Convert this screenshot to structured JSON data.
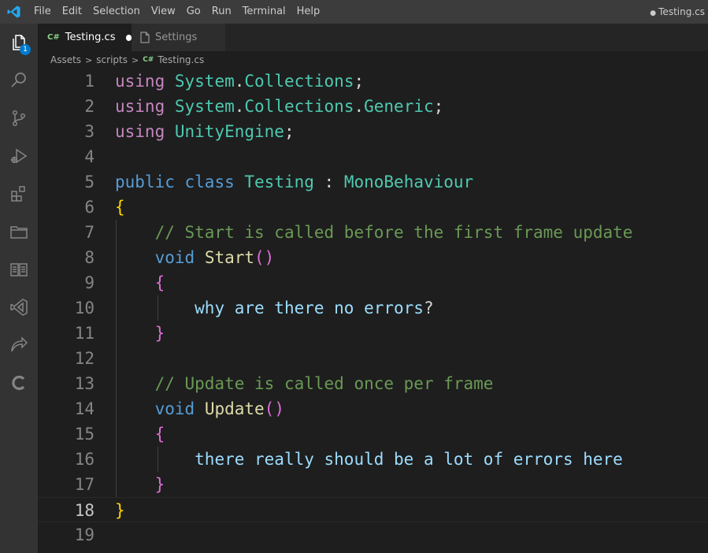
{
  "titlebar": {
    "menu": [
      "File",
      "Edit",
      "Selection",
      "View",
      "Go",
      "Run",
      "Terminal",
      "Help"
    ],
    "window_title": "Testing.cs",
    "modified_indicator": "●"
  },
  "activity_bar": {
    "explorer_badge": "1",
    "icons": [
      "explorer-icon",
      "search-icon",
      "source-control-icon",
      "run-debug-icon",
      "extensions-icon",
      "folder-icon",
      "book-icon",
      "visual-studio-icon",
      "remote-icon",
      "c-icon"
    ]
  },
  "tabs": [
    {
      "label": "Testing.cs",
      "icon": "C#",
      "modified": true,
      "active": true
    },
    {
      "label": "Settings",
      "icon": "file-icon",
      "active": false
    }
  ],
  "breadcrumb": [
    "Assets",
    "scripts",
    "Testing.cs"
  ],
  "breadcrumb_file_icon": "C#",
  "colors": {
    "keyword_control": "#c586c0",
    "keyword": "#569cd6",
    "type": "#4ec9b0",
    "comment": "#6a9955",
    "function": "#dcdcaa",
    "variable": "#9cdcfe",
    "text": "#d4d4d4",
    "bracket_1": "#ffd700",
    "bracket_2": "#da70d6",
    "accent": "#007acc"
  },
  "editor": {
    "current_line": 18,
    "lines": [
      {
        "n": "1",
        "tokens": [
          [
            "using",
            "keyword_control"
          ],
          [
            " ",
            "text"
          ],
          [
            "System",
            "type"
          ],
          [
            ".",
            "text"
          ],
          [
            "Collections",
            "type"
          ],
          [
            ";",
            "text"
          ]
        ]
      },
      {
        "n": "2",
        "tokens": [
          [
            "using",
            "keyword_control"
          ],
          [
            " ",
            "text"
          ],
          [
            "System",
            "type"
          ],
          [
            ".",
            "text"
          ],
          [
            "Collections",
            "type"
          ],
          [
            ".",
            "text"
          ],
          [
            "Generic",
            "type"
          ],
          [
            ";",
            "text"
          ]
        ]
      },
      {
        "n": "3",
        "tokens": [
          [
            "using",
            "keyword_control"
          ],
          [
            " ",
            "text"
          ],
          [
            "UnityEngine",
            "type"
          ],
          [
            ";",
            "text"
          ]
        ]
      },
      {
        "n": "4",
        "tokens": []
      },
      {
        "n": "5",
        "tokens": [
          [
            "public",
            "keyword"
          ],
          [
            " ",
            "text"
          ],
          [
            "class",
            "keyword"
          ],
          [
            " ",
            "text"
          ],
          [
            "Testing",
            "type"
          ],
          [
            " : ",
            "text"
          ],
          [
            "MonoBehaviour",
            "type"
          ]
        ]
      },
      {
        "n": "6",
        "tokens": [
          [
            "{",
            "bracket_1"
          ]
        ]
      },
      {
        "n": "7",
        "tokens": [
          [
            "    ",
            "text"
          ],
          [
            "// Start is called before the first frame update",
            "comment"
          ]
        ]
      },
      {
        "n": "8",
        "tokens": [
          [
            "    ",
            "text"
          ],
          [
            "void",
            "keyword"
          ],
          [
            " ",
            "text"
          ],
          [
            "Start",
            "function"
          ],
          [
            "()",
            "bracket_2"
          ]
        ]
      },
      {
        "n": "9",
        "tokens": [
          [
            "    ",
            "text"
          ],
          [
            "{",
            "bracket_2"
          ]
        ]
      },
      {
        "n": "10",
        "tokens": [
          [
            "        ",
            "text"
          ],
          [
            "why are there no errors",
            "variable"
          ],
          [
            "?",
            "text"
          ]
        ]
      },
      {
        "n": "11",
        "tokens": [
          [
            "    ",
            "text"
          ],
          [
            "}",
            "bracket_2"
          ]
        ]
      },
      {
        "n": "12",
        "tokens": []
      },
      {
        "n": "13",
        "tokens": [
          [
            "    ",
            "text"
          ],
          [
            "// Update is called once per frame",
            "comment"
          ]
        ]
      },
      {
        "n": "14",
        "tokens": [
          [
            "    ",
            "text"
          ],
          [
            "void",
            "keyword"
          ],
          [
            " ",
            "text"
          ],
          [
            "Update",
            "function"
          ],
          [
            "()",
            "bracket_2"
          ]
        ]
      },
      {
        "n": "15",
        "tokens": [
          [
            "    ",
            "text"
          ],
          [
            "{",
            "bracket_2"
          ]
        ]
      },
      {
        "n": "16",
        "tokens": [
          [
            "        ",
            "text"
          ],
          [
            "there really should be a lot of errors here",
            "variable"
          ]
        ]
      },
      {
        "n": "17",
        "tokens": [
          [
            "    ",
            "text"
          ],
          [
            "}",
            "bracket_2"
          ]
        ]
      },
      {
        "n": "18",
        "tokens": [
          [
            "}",
            "bracket_1"
          ]
        ]
      },
      {
        "n": "19",
        "tokens": []
      }
    ]
  }
}
